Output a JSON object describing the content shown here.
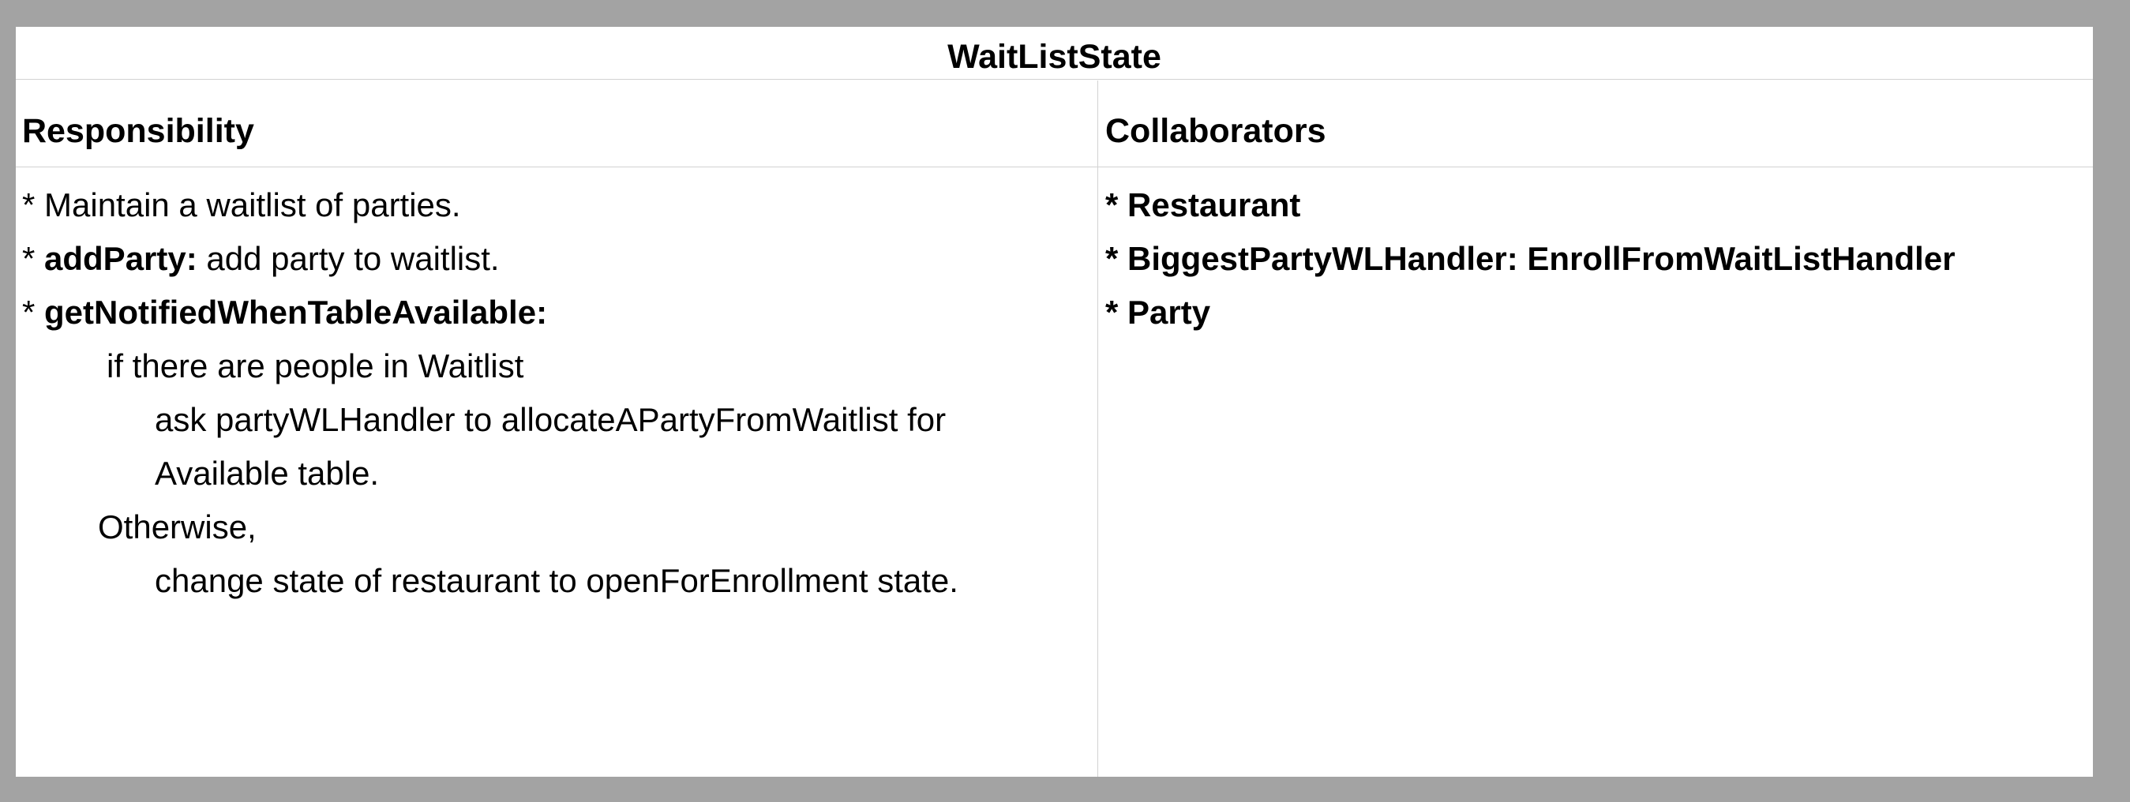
{
  "title": "WaitListState",
  "headers": {
    "responsibility": "Responsibility",
    "collaborators": "Collaborators"
  },
  "responsibilities": {
    "line1": "* Maintain a waitlist of parties.",
    "line2_prefix": "* ",
    "line2_bold": "addParty:",
    "line2_rest": " add party to waitlist.",
    "line3_prefix": "* ",
    "line3_bold": "getNotifiedWhenTableAvailable:",
    "line4": "if there are people in Waitlist",
    "line5": "ask partyWLHandler to allocateAPartyFromWaitlist for",
    "line6": "Available table.",
    "line7": "Otherwise,",
    "line8": "change state of restaurant to openForEnrollment state."
  },
  "collaborators": {
    "item1": "* Restaurant",
    "item2": "* BiggestPartyWLHandler: EnrollFromWaitListHandler",
    "item3": "* Party"
  }
}
